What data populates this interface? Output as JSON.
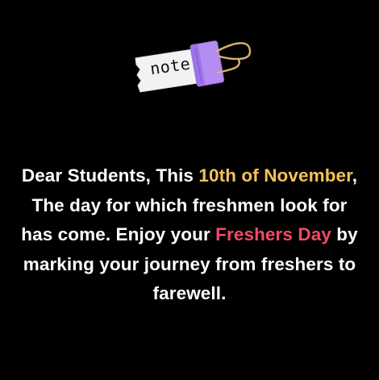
{
  "sticker": {
    "label": "note",
    "paper_color": "#f2f2f2",
    "clip_color": "#b48cf2",
    "wire_color": "#d9b46a"
  },
  "message": {
    "segments": [
      {
        "text": "Dear Students,  This ",
        "style": "plain"
      },
      {
        "text": "10th of November",
        "style": "date-highlight"
      },
      {
        "text": ", The day for which freshmen look for has come. Enjoy your ",
        "style": "plain"
      },
      {
        "text": "Freshers Day",
        "style": "event-highlight"
      },
      {
        "text": " by marking your journey from freshers to farewell.",
        "style": "plain"
      }
    ],
    "colors": {
      "text": "#ffffff",
      "date_highlight": "#f4c15a",
      "event_highlight": "#f24b63",
      "background": "#000000"
    }
  }
}
